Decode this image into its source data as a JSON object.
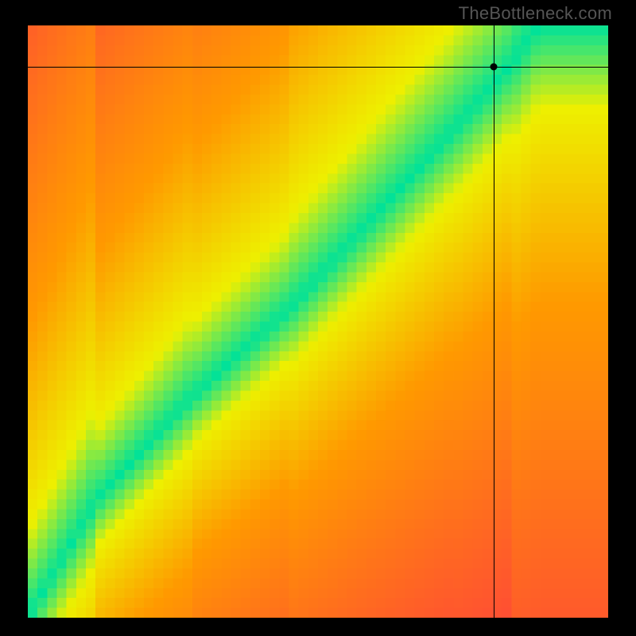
{
  "watermark": "TheBottleneck.com",
  "chart_data": {
    "type": "heatmap",
    "title": "",
    "xlabel": "",
    "ylabel": "",
    "xlim": [
      0,
      100
    ],
    "ylim": [
      0,
      100
    ],
    "grid": false,
    "description": "Diagonal optimal-match heatmap. A curved green ridge runs from (0,0) lower-left to (~88,100) upper-right, surrounded by a yellow band, fading through orange to red toward the off-diagonal corners (lower-right redder than upper-left).",
    "crosshair": {
      "x": 80.3,
      "y": 93.0
    },
    "ridge_points": [
      {
        "x": 0,
        "y": 0
      },
      {
        "x": 12,
        "y": 20
      },
      {
        "x": 28,
        "y": 37
      },
      {
        "x": 45,
        "y": 52
      },
      {
        "x": 60,
        "y": 68
      },
      {
        "x": 74,
        "y": 83
      },
      {
        "x": 83,
        "y": 93
      },
      {
        "x": 88,
        "y": 100
      }
    ],
    "color_stops": {
      "best": "#00e29a",
      "good": "#eef000",
      "mid": "#ff9a00",
      "bad": "#ff2b4c"
    },
    "pixelation": 60
  }
}
